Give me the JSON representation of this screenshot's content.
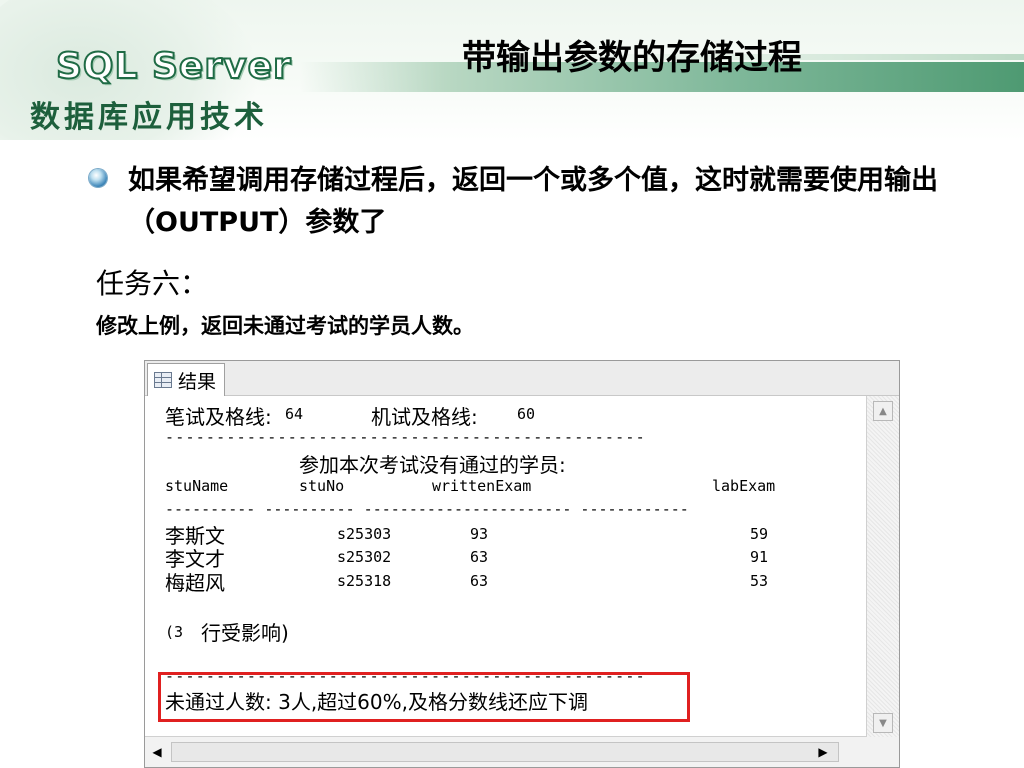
{
  "header": {
    "logo_title": "SQL Server",
    "logo_subtitle": "数据库应用技术",
    "slide_title": "带输出参数的存储过程"
  },
  "bullet": {
    "icon": "bullet-orb-icon",
    "text": "如果希望调用存储过程后，返回一个或多个值，这时就需要使用输出（OUTPUT）参数了"
  },
  "task": {
    "title": "任务六：",
    "description": "修改上例，返回未通过考试的学员人数。"
  },
  "results": {
    "tab_label": "结果",
    "tab_icon": "grid-icon",
    "pass_line_label1": "笔试及格线:",
    "pass_line_value1": "64",
    "pass_line_label2": "机试及格线:",
    "pass_line_value2": "60",
    "separator": "-----------------------------------------------",
    "section_caption": "参加本次考试没有通过的学员:",
    "columns": [
      "stuName",
      "stuNo",
      "writtenExam",
      "labExam"
    ],
    "column_underline": "---------- ---------- ----------------------- ------------",
    "rows": [
      {
        "stuName": "李斯文",
        "stuNo": "s25303",
        "writtenExam": "93",
        "labExam": "59"
      },
      {
        "stuName": "李文才",
        "stuNo": "s25302",
        "writtenExam": "63",
        "labExam": "91"
      },
      {
        "stuName": "梅超风",
        "stuNo": "s25318",
        "writtenExam": "63",
        "labExam": "53"
      }
    ],
    "rows_affected_prefix": "(3",
    "rows_affected_text": "行受影响)",
    "separator2": "-----------------------------------------------",
    "summary_text": "未通过人数: 3人,超过60%,及格分数线还应下调"
  },
  "colors": {
    "highlight_border": "#e02020",
    "logo_green": "#1f6b45"
  }
}
